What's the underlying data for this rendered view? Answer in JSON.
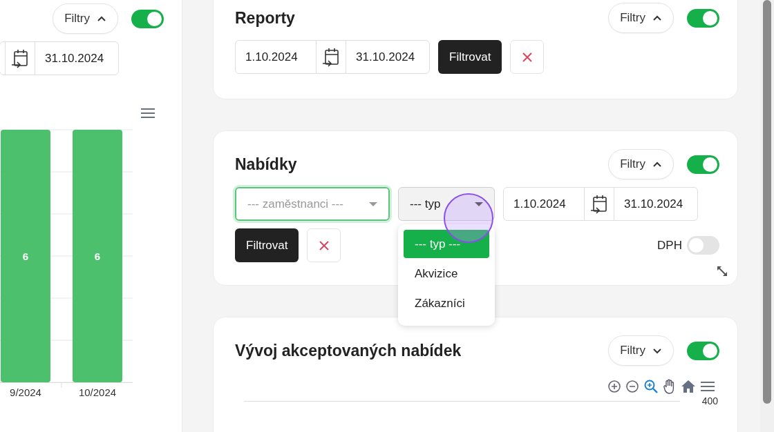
{
  "left_panel": {
    "filter_button": {
      "label": "Filtry",
      "expanded": true
    },
    "enabled": true,
    "date_to": "31.10.2024",
    "chart_data": {
      "type": "bar",
      "categories": [
        "9/2024",
        "10/2024"
      ],
      "values": [
        6,
        6
      ],
      "data_labels": true
    }
  },
  "reports": {
    "title": "Reporty",
    "filter_button": {
      "label": "Filtry",
      "expanded": true
    },
    "enabled": true,
    "date_from": "1.10.2024",
    "date_to": "31.10.2024",
    "submit": "Filtrovat"
  },
  "offers": {
    "title": "Nabídky",
    "filter_button": {
      "label": "Filtry",
      "expanded": true
    },
    "enabled": true,
    "employee_select": {
      "placeholder": "--- zaměstnanci ---",
      "focused": true
    },
    "type_select": {
      "value": "--- typ",
      "expanded": true,
      "options": [
        {
          "label": "--- typ ---",
          "selected": true
        },
        {
          "label": "Akvizice",
          "selected": false
        },
        {
          "label": "Zákazníci",
          "selected": false
        }
      ]
    },
    "date_from": "1.10.2024",
    "date_to": "31.10.2024",
    "submit": "Filtrovat",
    "vat_toggle": {
      "label": "DPH",
      "on": false
    }
  },
  "trend": {
    "title": "Vývoj akceptovaných nabídek",
    "filter_button": {
      "label": "Filtry",
      "expanded": false
    },
    "enabled": true,
    "y_tick": "400"
  }
}
